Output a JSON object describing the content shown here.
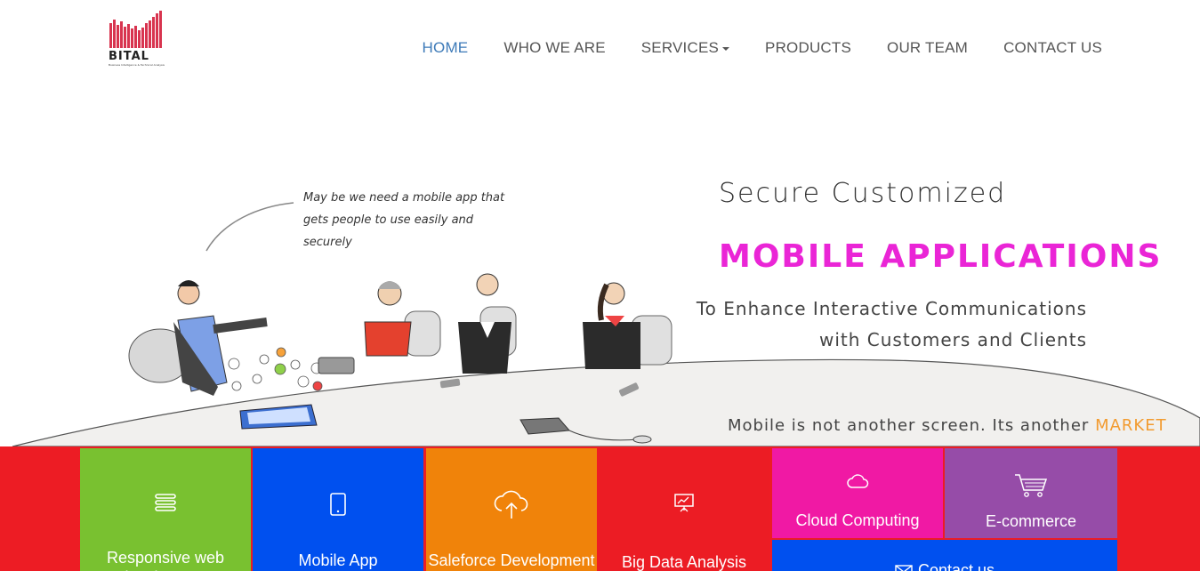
{
  "brand": {
    "name": "BITAL",
    "tagline": "Business Intelligence & Technical Analysis"
  },
  "nav": {
    "items": [
      {
        "label": "HOME",
        "active": true
      },
      {
        "label": "WHO WE ARE",
        "active": false
      },
      {
        "label": "SERVICES",
        "active": false,
        "dropdown": true
      },
      {
        "label": "PRODUCTS",
        "active": false
      },
      {
        "label": "OUR TEAM",
        "active": false
      },
      {
        "label": "CONTACT US",
        "active": false
      }
    ]
  },
  "hero": {
    "speech": "May be we need a mobile app that gets people to use easily and securely",
    "title_line1": "Secure Customized",
    "title_line2": "MOBILE APPLICATIONS",
    "subtitle_line1": "To Enhance Interactive Communications",
    "subtitle_line2": "with Customers and Clients",
    "tagline_prefix": "Mobile is not another screen. Its another",
    "tagline_accent": "MARKET"
  },
  "tiles": [
    {
      "label": "Responsive web development",
      "icon": "stack-icon",
      "color": "#79c130"
    },
    {
      "label": "Mobile App Development",
      "icon": "tablet-icon",
      "color": "#0050ef"
    },
    {
      "label": "Saleforce Development",
      "icon": "cloud-upload-icon",
      "color": "#f0830a"
    },
    {
      "label": "Big Data Analysis",
      "icon": "presentation-icon",
      "color": "#ec1c24"
    },
    {
      "label": "Cloud Computing",
      "icon": "cloud-icon",
      "color": "#f019a4"
    },
    {
      "label": "E-commerce",
      "icon": "cart-icon",
      "color": "#964ca8"
    },
    {
      "label": "Contact us",
      "icon": "mail-icon",
      "color": "#0050ef"
    }
  ],
  "colors": {
    "accent_nav": "#3d7ab8",
    "headline_magenta": "#ea25d6",
    "market_orange": "#f29b30",
    "tile_band_red": "#ed1c24"
  }
}
